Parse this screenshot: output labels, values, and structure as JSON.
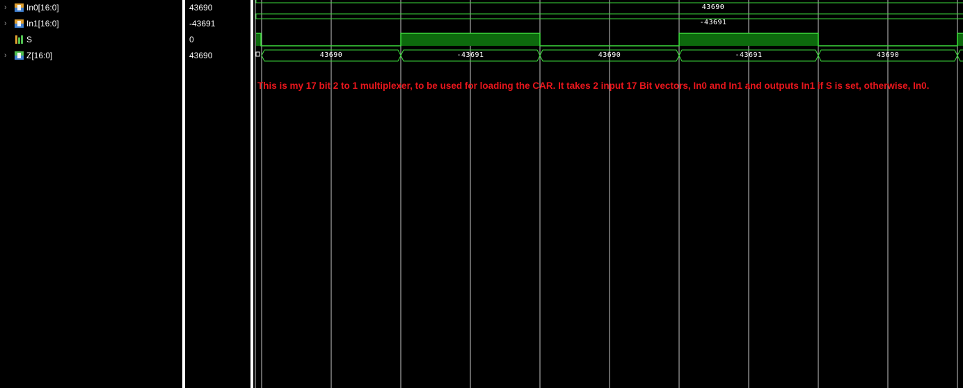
{
  "signals": [
    {
      "name": "In0[16:0]",
      "value": "43690",
      "kind": "bus",
      "expandable": true
    },
    {
      "name": "In1[16:0]",
      "value": "-43691",
      "kind": "bus",
      "expandable": true
    },
    {
      "name": "S",
      "value": "0",
      "kind": "bit",
      "expandable": false
    },
    {
      "name": "Z[16:0]",
      "value": "43690",
      "kind": "bus",
      "expandable": true
    }
  ],
  "waves": {
    "in0_label": "43690",
    "in1_label": "-43691",
    "z_labels": [
      "43690",
      "-43691",
      "43690",
      "-43691",
      "43690"
    ]
  },
  "note": "This is my 17 bit 2 to 1 multiplexer, to be used for loading the CAR. It takes 2 input 17 Bit vectors, In0 and In1 and outputs In1 if S is set, otherwise, In0.",
  "colors": {
    "wave": "#3cdc3c",
    "wave_fill": "#0d6a0d",
    "grid": "#c8c8c8",
    "note": "#e8161c",
    "icon_bus_top": "#e0a030",
    "icon_bus_bottom": "#4080d0",
    "icon_bit": "#50c050"
  }
}
